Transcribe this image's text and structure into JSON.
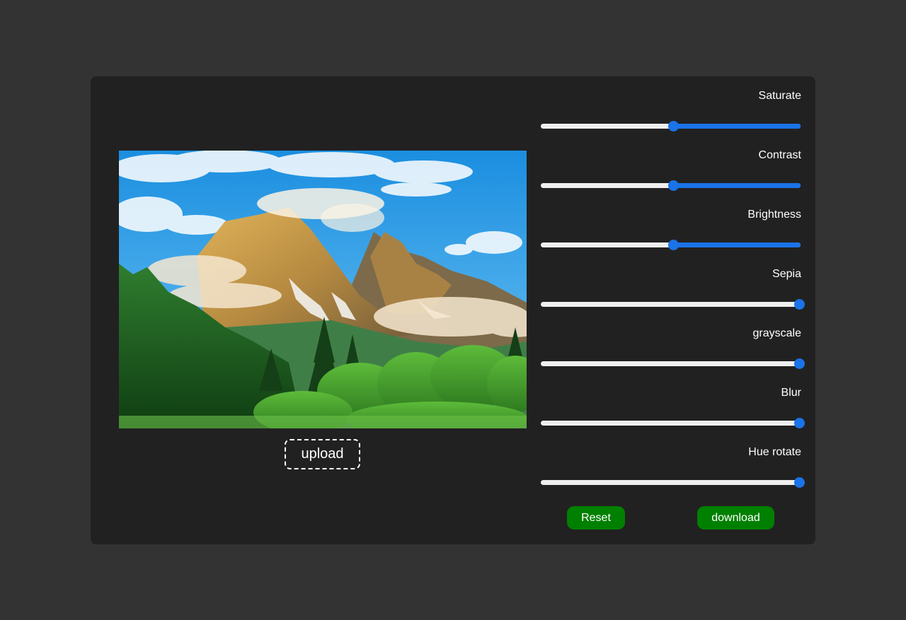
{
  "upload_label": "upload",
  "buttons": {
    "reset_label": "Reset",
    "download_label": "download",
    "color": "#008000"
  },
  "accent_color": "#1a73e8",
  "controls": [
    {
      "label": "Saturate",
      "value": 0.5,
      "fill": "after"
    },
    {
      "label": "Contrast",
      "value": 0.5,
      "fill": "after"
    },
    {
      "label": "Brightness",
      "value": 0.5,
      "fill": "after"
    },
    {
      "label": "Sepia",
      "value": 1.0,
      "fill": "none"
    },
    {
      "label": "grayscale",
      "value": 1.0,
      "fill": "none"
    },
    {
      "label": "Blur",
      "value": 1.0,
      "fill": "none"
    },
    {
      "label": "Hue rotate",
      "value": 1.0,
      "fill": "none"
    }
  ],
  "preview_image": "mountain-landscape"
}
